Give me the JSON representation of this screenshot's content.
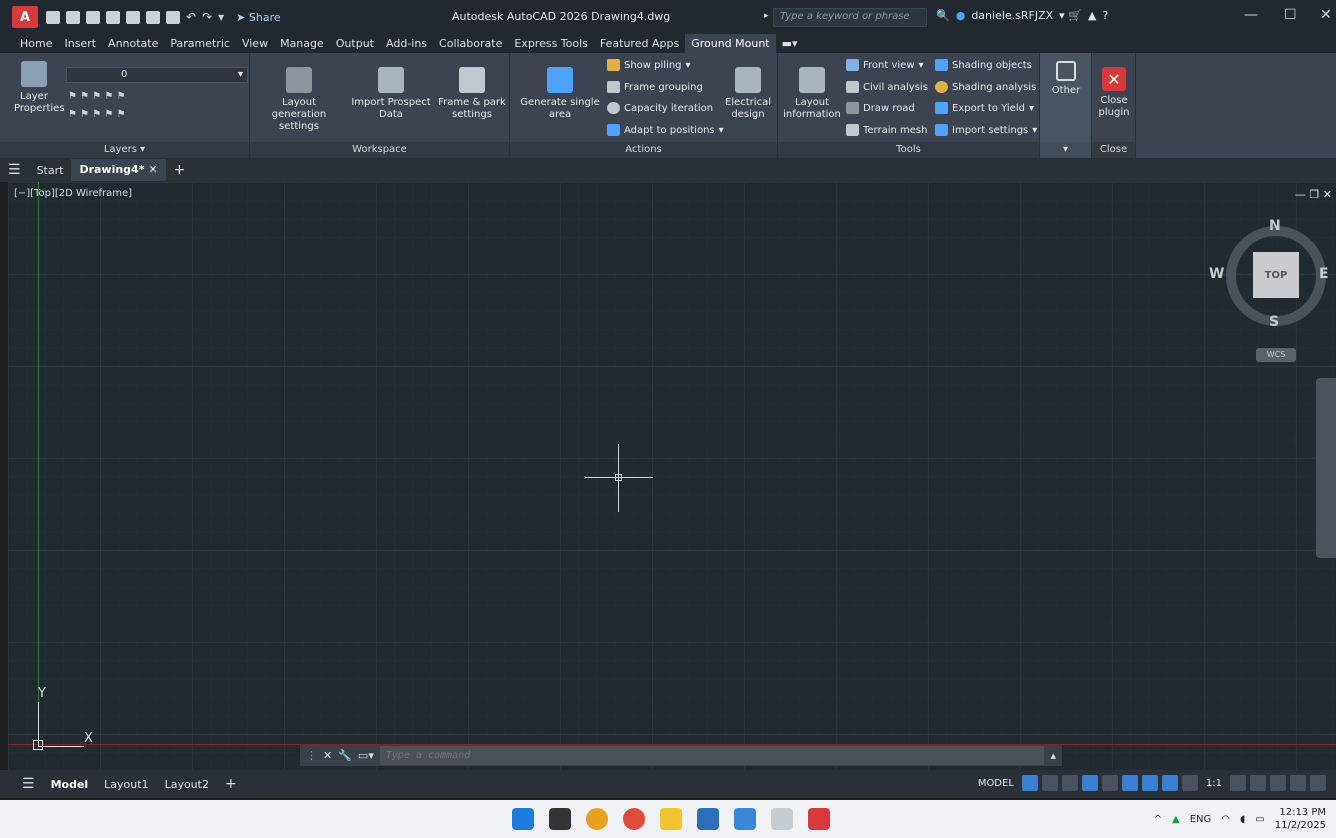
{
  "titlebar": {
    "app_logo": "A",
    "share_label": "Share",
    "doc_title": "Autodesk AutoCAD 2026  Drawing4.dwg",
    "search_placeholder": "Type a keyword or phrase",
    "user_name": "daniele.sRFJZX"
  },
  "ribbon_tabs": [
    "Home",
    "Insert",
    "Annotate",
    "Parametric",
    "View",
    "Manage",
    "Output",
    "Add-ins",
    "Collaborate",
    "Express Tools",
    "Featured Apps",
    "Ground Mount"
  ],
  "ribbon": {
    "layers": {
      "title": "Layers ▾",
      "btn": "Layer Properties",
      "layer_value": "0"
    },
    "workspace": {
      "title": "Workspace",
      "btn1": "Layout generation settings",
      "btn2": "Import Prospect Data",
      "btn3": "Frame & park settings"
    },
    "actions": {
      "title": "Actions",
      "btn1": "Generate single area",
      "s1": "Show piling",
      "s2": "Frame grouping",
      "s3": "Capacity iteration",
      "s4": "Adapt to positions",
      "btn2": "Electrical design"
    },
    "tools": {
      "title": "Tools",
      "btn1": "Layout information",
      "s1": "Front view",
      "s2": "Civil analysis",
      "s3": "Draw road",
      "s4": "Terrain mesh",
      "s5": "Shading objects",
      "s6": "Shading analysis",
      "s7": "Export to Yield",
      "s8": "Import settings"
    },
    "other": {
      "label": "Other"
    },
    "close": {
      "title": "Close",
      "btn": "Close plugin"
    }
  },
  "filetabs": {
    "start": "Start",
    "drawing": "Drawing4*"
  },
  "viewport": {
    "label": "[−][Top][2D Wireframe]",
    "viewcube_top": "TOP",
    "dir_n": "N",
    "dir_s": "S",
    "dir_e": "E",
    "dir_w": "W",
    "wcs": "WCS",
    "ucs_x": "X",
    "ucs_y": "Y"
  },
  "command": {
    "placeholder": "Type a command"
  },
  "layout_tabs": [
    "Model",
    "Layout1",
    "Layout2"
  ],
  "status": {
    "model": "MODEL",
    "scale": "1:1"
  },
  "taskbar": {
    "lang": "ENG",
    "time": "12:13 PM",
    "date": "11/2/2025"
  }
}
